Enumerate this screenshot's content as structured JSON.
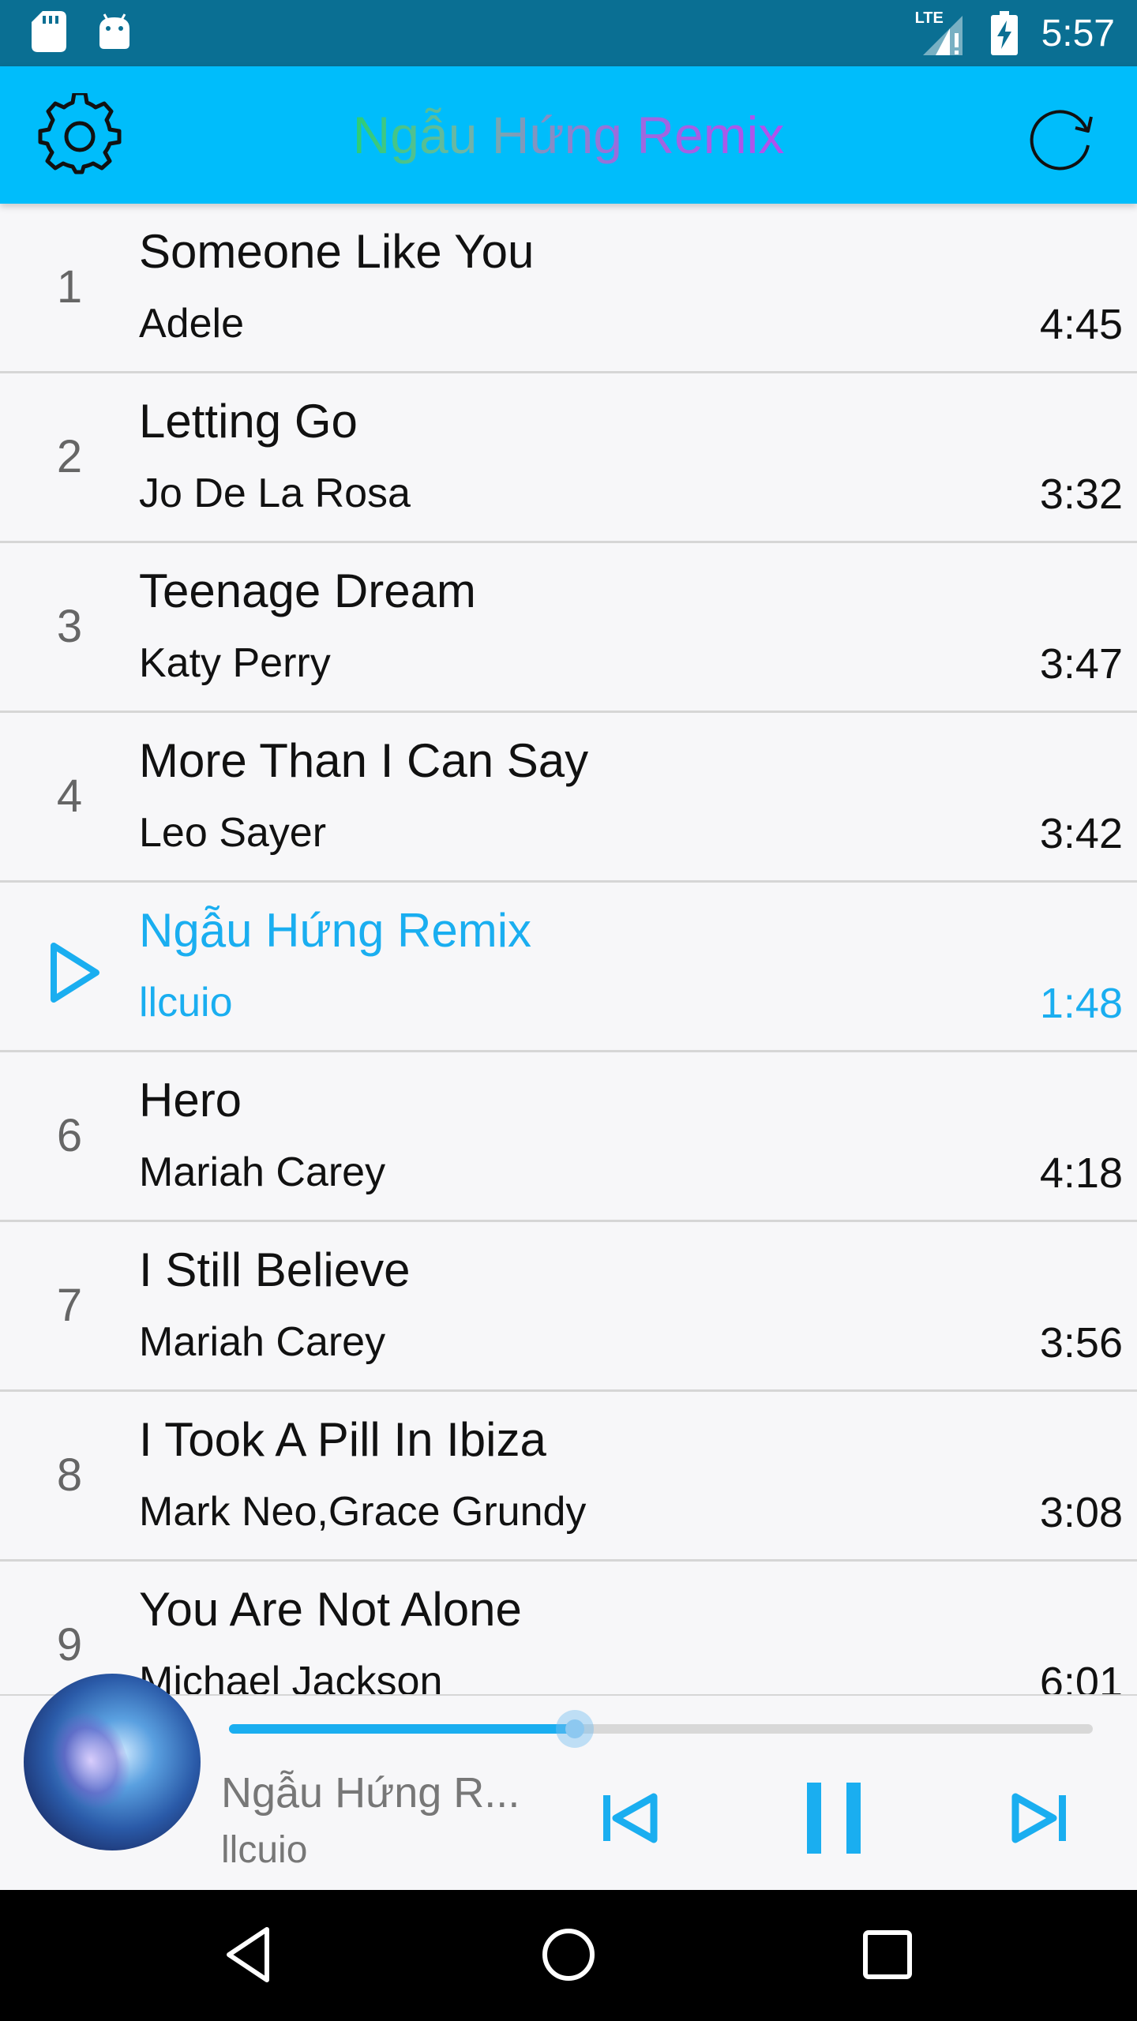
{
  "status_bar": {
    "time": "5:57",
    "network": "LTE",
    "left_icons": [
      "sd-card-icon",
      "android-icon"
    ],
    "right_icons": [
      "signal-icon",
      "battery-charging-icon"
    ]
  },
  "app_bar": {
    "title": "Ngẫu Hứng Remix",
    "left_icon": "gear-icon",
    "right_icon": "refresh-icon",
    "background": "#00bdfb"
  },
  "tracks": [
    {
      "number": "1",
      "title": "Someone Like You",
      "artist": "Adele",
      "duration": "4:45"
    },
    {
      "number": "2",
      "title": "Letting Go",
      "artist": "Jo De La Rosa",
      "duration": "3:32"
    },
    {
      "number": "3",
      "title": "Teenage Dream",
      "artist": "Katy Perry",
      "duration": "3:47"
    },
    {
      "number": "4",
      "title": "More Than I Can Say",
      "artist": "Leo Sayer",
      "duration": "3:42"
    },
    {
      "number": "5",
      "title": "Ngẫu Hứng Remix",
      "artist": "llcuio",
      "duration": "1:48",
      "playing": true
    },
    {
      "number": "6",
      "title": "Hero",
      "artist": "Mariah Carey",
      "duration": "4:18"
    },
    {
      "number": "7",
      "title": "I Still Believe",
      "artist": "Mariah Carey",
      "duration": "3:56"
    },
    {
      "number": "8",
      "title": "I Took A Pill In Ibiza",
      "artist": "Mark Neo,Grace Grundy",
      "duration": "3:08"
    },
    {
      "number": "9",
      "title": "You Are Not Alone",
      "artist": "Michael Jackson",
      "duration": "6:01"
    }
  ],
  "player": {
    "title": "Ngẫu Hứng R...",
    "artist": "llcuio",
    "progress": 0.4,
    "controls": [
      "skip-previous-icon",
      "pause-icon",
      "skip-next-icon"
    ],
    "accent": "#1aaef0"
  },
  "nav_bar": {
    "buttons": [
      "back-icon",
      "home-icon",
      "recents-icon"
    ]
  }
}
